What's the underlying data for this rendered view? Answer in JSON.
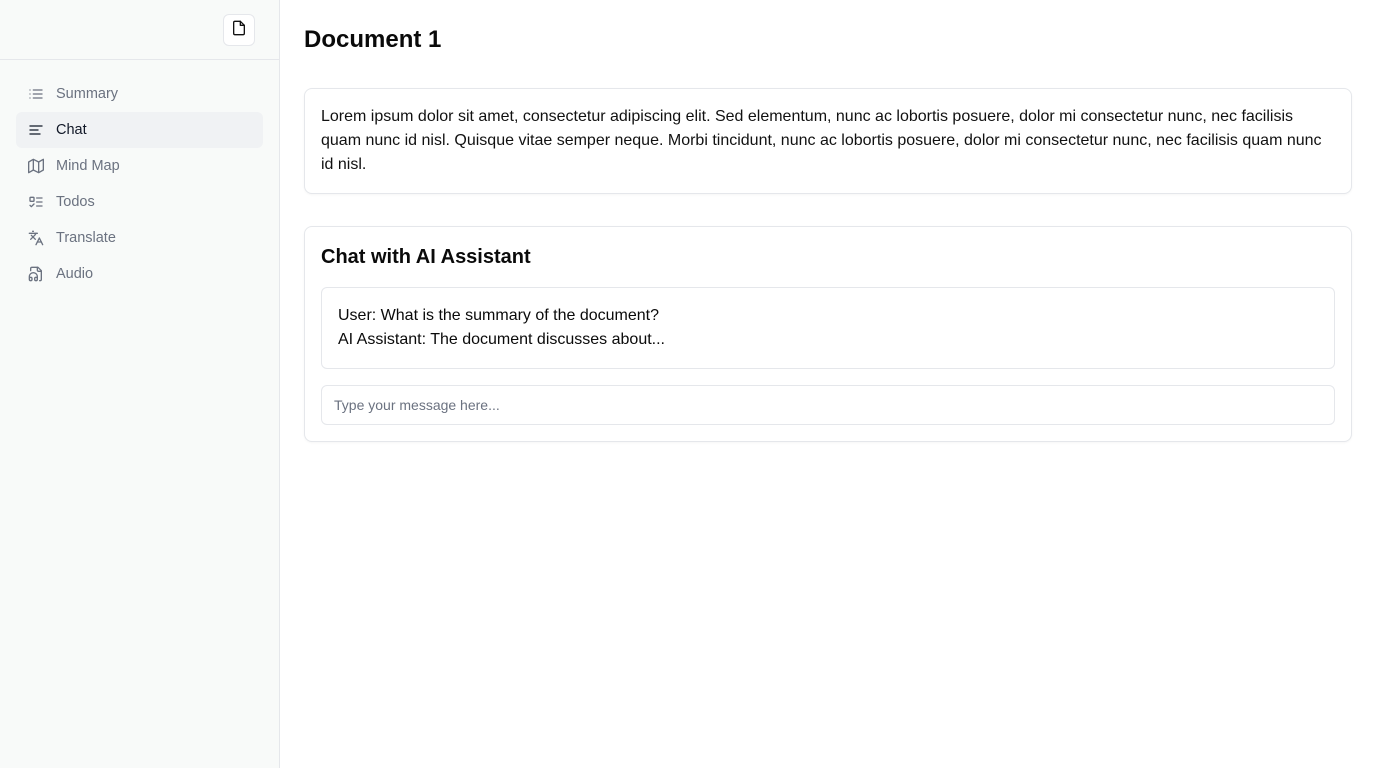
{
  "sidebar": {
    "new_doc_icon": "file-icon",
    "items": [
      {
        "label": "Summary",
        "icon": "list-icon",
        "active": false
      },
      {
        "label": "Chat",
        "icon": "text-lines-icon",
        "active": true
      },
      {
        "label": "Mind Map",
        "icon": "map-icon",
        "active": false
      },
      {
        "label": "Todos",
        "icon": "list-todo-icon",
        "active": false
      },
      {
        "label": "Translate",
        "icon": "languages-icon",
        "active": false
      },
      {
        "label": "Audio",
        "icon": "file-audio-icon",
        "active": false
      }
    ]
  },
  "main": {
    "title": "Document 1",
    "document_text": "Lorem ipsum dolor sit amet, consectetur adipiscing elit. Sed elementum, nunc ac lobortis posuere, dolor mi consectetur nunc, nec facilisis quam nunc id nisl. Quisque vitae semper neque. Morbi tincidunt, nunc ac lobortis posuere, dolor mi consectetur nunc, nec facilisis quam nunc id nisl.",
    "chat": {
      "title": "Chat with AI Assistant",
      "messages": [
        "User: What is the summary of the document?",
        "AI Assistant: The document discusses about..."
      ],
      "input_placeholder": "Type your message here..."
    }
  },
  "colors": {
    "sidebar_bg": "#f8faf9",
    "active_item_bg": "#f0f2f4",
    "muted_text": "#6b7280",
    "border": "#e5e7eb"
  }
}
